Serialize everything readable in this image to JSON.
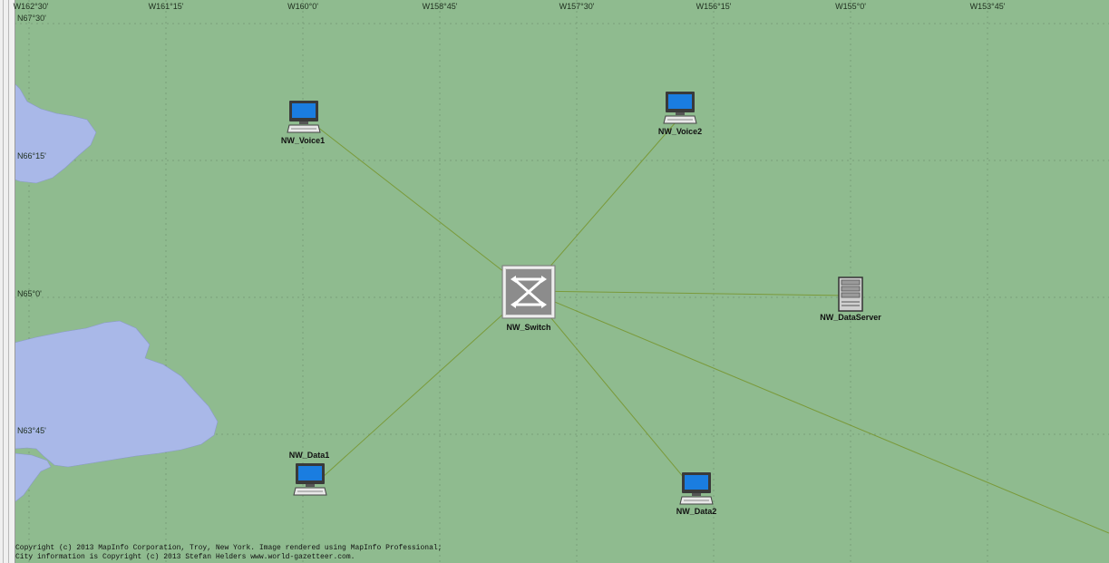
{
  "map": {
    "longitudes": [
      "W162°30'",
      "W161°15'",
      "W160°0'",
      "W158°45'",
      "W157°30'",
      "W156°15'",
      "W155°0'",
      "W153°45'"
    ],
    "latitudes": [
      "N67°30'",
      "N66°15'",
      "N65°0'",
      "N63°45'"
    ],
    "colors": {
      "land": "#8fbb8f",
      "water": "#a9b8e8",
      "link": "#7a9a3a",
      "grid": "#6f946f"
    }
  },
  "nodes": {
    "voice1": {
      "label": "NW_Voice1",
      "icon": "workstation-icon"
    },
    "voice2": {
      "label": "NW_Voice2",
      "icon": "workstation-icon"
    },
    "switch": {
      "label": "NW_Switch",
      "icon": "switch-icon"
    },
    "dataserver": {
      "label": "NW_DataServer",
      "icon": "server-icon"
    },
    "data1": {
      "label": "NW_Data1",
      "icon": "workstation-icon"
    },
    "data2": {
      "label": "NW_Data2",
      "icon": "workstation-icon"
    }
  },
  "copyright": {
    "line1": "Copyright (c) 2013 MapInfo Corporation, Troy, New York. Image rendered using MapInfo Professional;",
    "line2": "City information is Copyright (c) 2013 Stefan Helders www.world-gazetteer.com."
  }
}
